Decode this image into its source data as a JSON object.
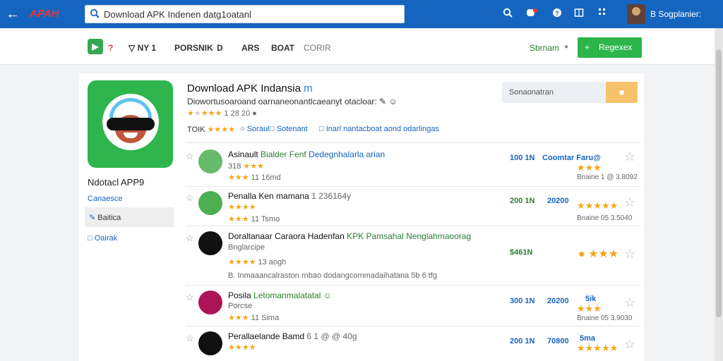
{
  "topbar": {
    "logo": "APAH",
    "search_value": "Download APK Indenen datg1oatanl",
    "user_name": "B Sogplanier:",
    "icons": [
      "search-icon",
      "notification-icon",
      "help-icon",
      "calendar-icon",
      "apps-icon"
    ]
  },
  "subbar": {
    "dot": "?",
    "nav": [
      "NY 1",
      "PORSNIK",
      "D",
      "ARS",
      "BOAT",
      "CORIR"
    ],
    "sort_label": "Sbrnam",
    "button_label": "Regexex",
    "button_plus": "+"
  },
  "sidebar": {
    "app_name": "Ndotacl APP9",
    "links": [
      "Canaesce",
      "Baitica",
      "Oairak"
    ]
  },
  "header": {
    "title": "Download APK Indansia",
    "title_suffix": "m",
    "subtitle": "Diowortusoaroand oarnaneonantlcaeanyt otacloar: ✎ ☺",
    "meta_rating": "1 28 20",
    "meta_count": "TOIK",
    "meta_link1": "Soraul",
    "meta_link2": "Sotenant",
    "meta_link3": "Inarl nantacboat aond odarlingas",
    "search_placeholder": "Sonaonatran"
  },
  "apps": [
    {
      "title": "Asinault",
      "title_green": "Bialder Fenf",
      "title_blue": "Dedegnhalarla arian",
      "line2": "318",
      "line3": "11   16md",
      "downloads": "100 1N",
      "version": "Coomtar Faru@",
      "date": "Bnaine 1 @ 3.8092",
      "stars": "★★★",
      "avatar_color": "#66bb6a"
    },
    {
      "title": "Penalla Ken mamana",
      "title_green": "",
      "title_blue": "",
      "line1_extra": "1 236164y",
      "line2": "",
      "line3": "11   Tsmo",
      "downloads": "200 1N",
      "version": "20200",
      "date": "Bnaine 05  3.5040",
      "stars": "★★★★★",
      "avatar_color": "#4caf50"
    },
    {
      "title": "Doraltanaar Caraora Hadenfan",
      "title_green": "KPK Pamsahal Nenglahmaoorag",
      "title_blue": "",
      "line2": "Bnglarcipe",
      "line3": "13 aogh",
      "line4": "B. Inmaaancalraston  rnbao dodangcommadaihatana  5b 6 tfg",
      "downloads": "$461N",
      "version": "",
      "date": "",
      "stars": "★★★",
      "avatar_color": "#111111"
    },
    {
      "title": "Posila",
      "title_green": "Letomanmalatatal",
      "title_blue": "",
      "line2": "Porcse",
      "line3": "11   Sima",
      "downloads": "300 1N",
      "version": "20200",
      "version2": "5ik",
      "date": "Bnaine 05  3.9030",
      "stars": "★★★",
      "avatar_color": "#ad1457"
    },
    {
      "title": "Perallaelande Bamd",
      "title_green": "",
      "title_blue": "",
      "line1_extra": "6 1 @ @ 40g",
      "line2": "",
      "downloads": "200 1N",
      "version": "70800",
      "version2": "5ma",
      "date": "",
      "stars": "★★★★★",
      "avatar_color": "#111111"
    }
  ]
}
